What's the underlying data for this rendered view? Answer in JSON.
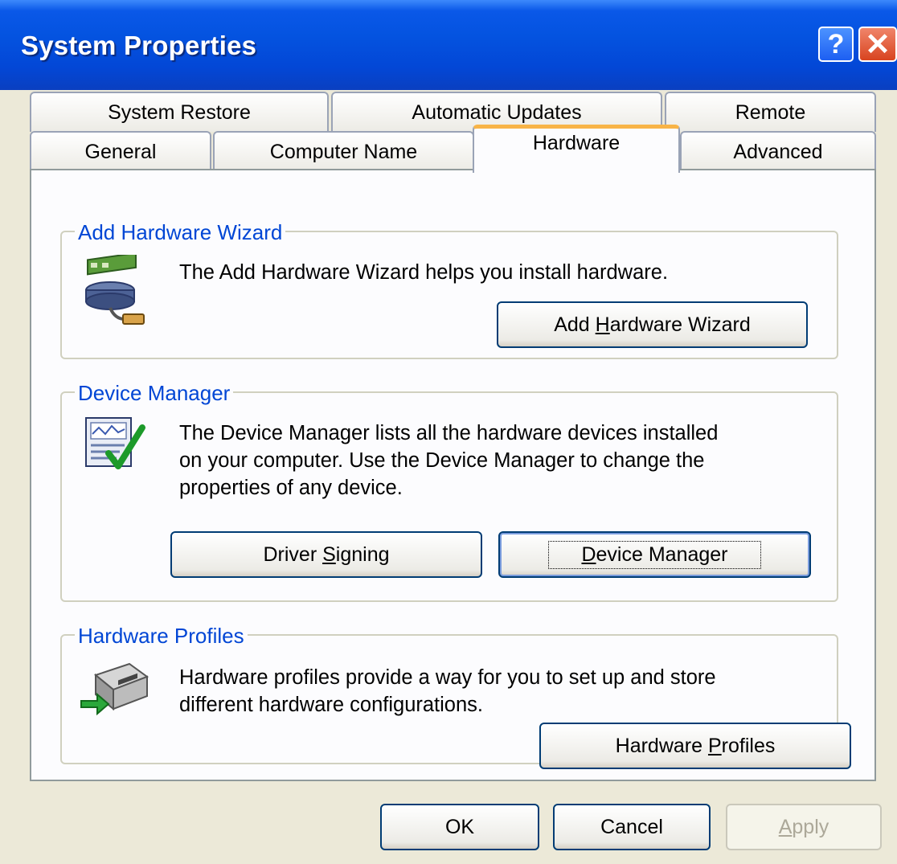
{
  "window": {
    "title": "System Properties"
  },
  "titlebar": {
    "help_glyph": "?",
    "close_glyph": "✕"
  },
  "tabs_top": [
    {
      "label": "System Restore"
    },
    {
      "label": "Automatic Updates"
    },
    {
      "label": "Remote"
    }
  ],
  "tabs_bottom": [
    {
      "label": "General"
    },
    {
      "label": "Computer Name"
    },
    {
      "label": "Hardware",
      "active": true
    },
    {
      "label": "Advanced"
    }
  ],
  "add_hardware": {
    "title": "Add Hardware Wizard",
    "description": "The Add Hardware Wizard helps you install hardware.",
    "button_pre": "Add ",
    "button_key": "H",
    "button_post": "ardware Wizard",
    "icon": "add-hardware-icon"
  },
  "device_manager": {
    "title": "Device Manager",
    "description_lines": [
      "The Device Manager lists all the hardware devices installed",
      "on your computer. Use the Device Manager to change the",
      "properties of any device."
    ],
    "driver_pre": "Driver ",
    "driver_key": "S",
    "driver_post": "igning",
    "dm_pre": "",
    "dm_key": "D",
    "dm_post": "evice Manager",
    "icon": "device-manager-icon"
  },
  "hardware_profiles": {
    "title": "Hardware Profiles",
    "description_lines": [
      "Hardware profiles provide a way for you to set up and store",
      "different hardware configurations."
    ],
    "button_pre": "Hardware ",
    "button_key": "P",
    "button_post": "rofiles",
    "icon": "hardware-profiles-icon"
  },
  "footer": {
    "ok": "OK",
    "cancel": "Cancel",
    "apply_key": "A",
    "apply_post": "pply"
  },
  "colors": {
    "title_bar": "#0453e0",
    "group_title": "#0046d5",
    "active_tab_accent": "#f8b447",
    "dialog_bg": "#ece9d8"
  }
}
